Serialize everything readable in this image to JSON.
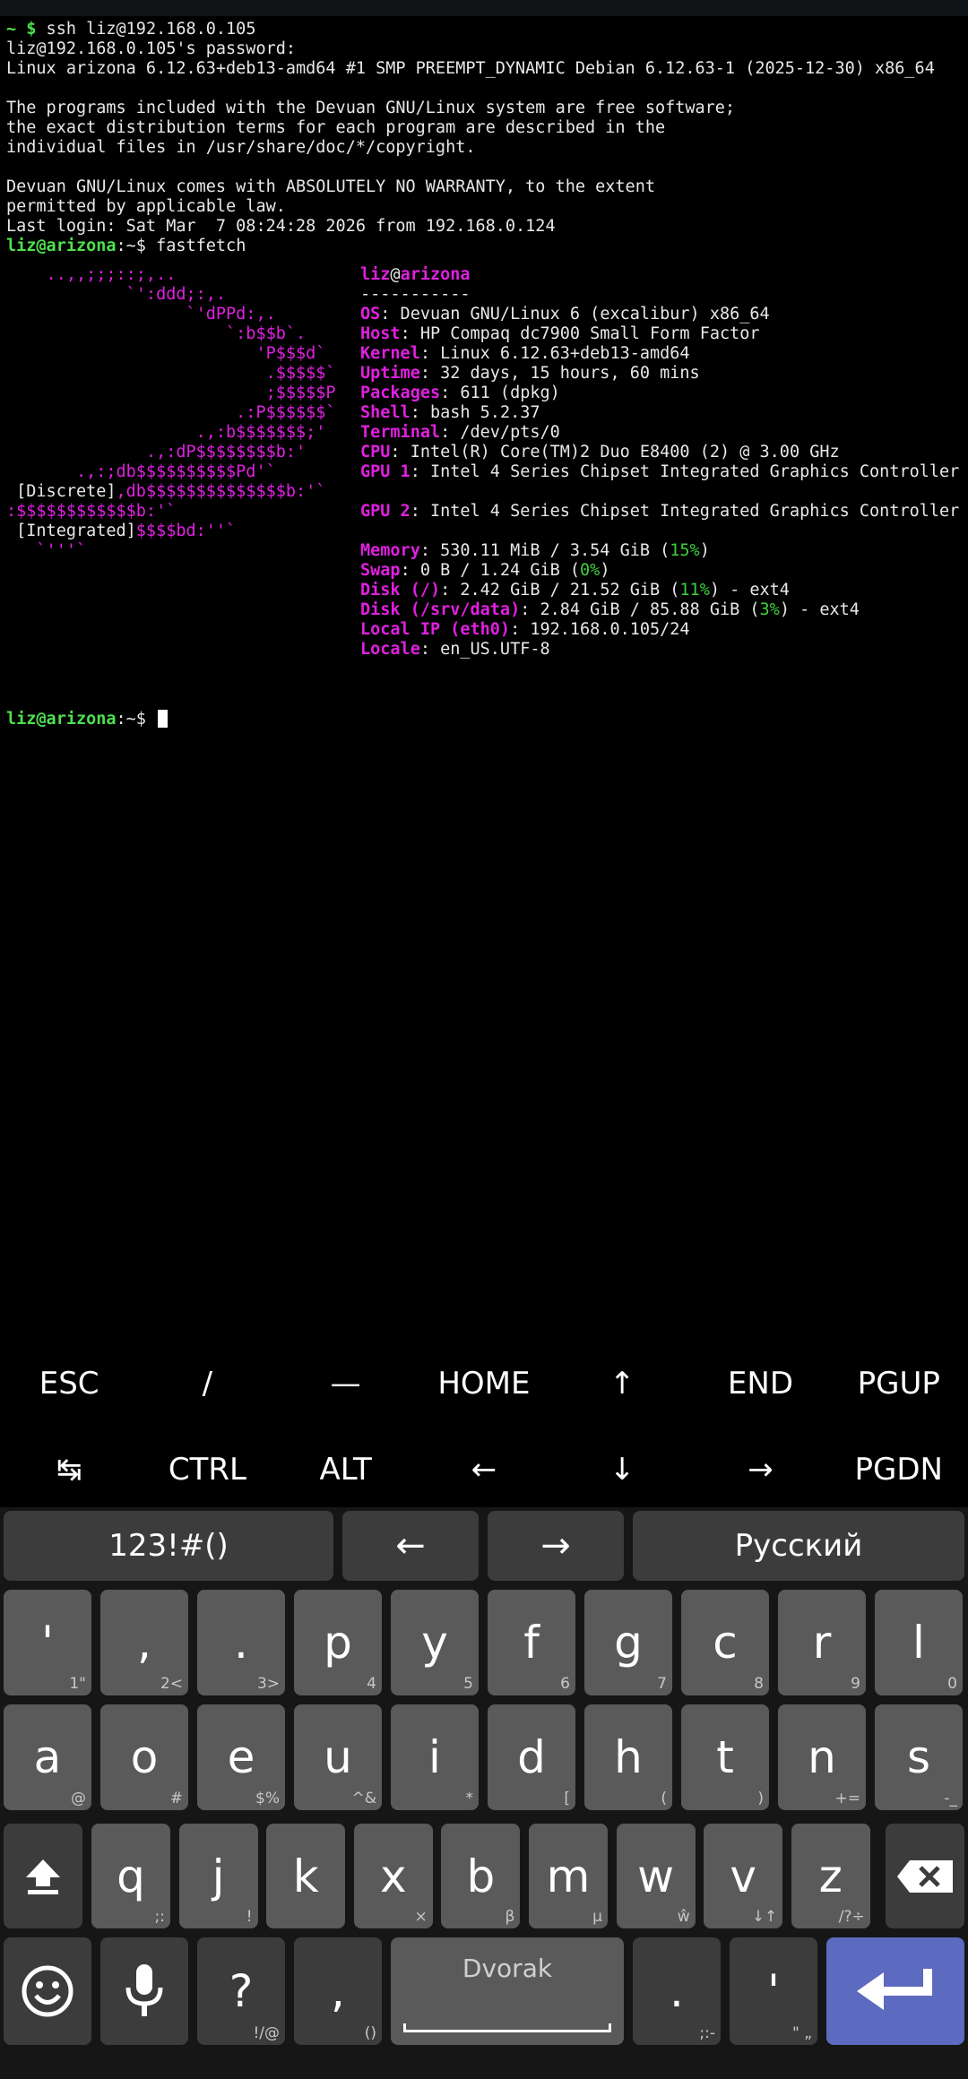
{
  "terminal": {
    "lines": [
      {
        "prompt": "~ $",
        "cmd": " ssh liz@192.168.0.105"
      },
      {
        "text": "liz@192.168.0.105's password:"
      },
      {
        "text": "Linux arizona 6.12.63+deb13-amd64 #1 SMP PREEMPT_DYNAMIC Debian 6.12.63-1 (2025-12-30) x86_64"
      },
      {
        "text": "The programs included with the Devuan GNU/Linux system are free software;"
      },
      {
        "text": "the exact distribution terms for each program are described in the"
      },
      {
        "text": "individual files in /usr/share/doc/*/copyright."
      },
      {
        "text": "Devuan GNU/Linux comes with ABSOLUTELY NO WARRANTY, to the extent"
      },
      {
        "text": "permitted by applicable law."
      },
      {
        "text": "Last login: Sat Mar  7 08:24:28 2026 from 192.168.0.124"
      },
      {
        "prompt": "liz@arizona",
        "sep": ":~$",
        "cmd": " fastfetch"
      }
    ],
    "logo": [
      {
        "a": "    ..,,;;;::;,..",
        "b": ""
      },
      {
        "a": "            `':ddd;:,.",
        "b": ""
      },
      {
        "a": "                  `'dPPd:,.",
        "b": ""
      },
      {
        "a": "                      `:b$$b`.",
        "b": ""
      },
      {
        "a": "                         'P$$$d`",
        "b": ""
      },
      {
        "a": "                          .$$$$$`",
        "b": ""
      },
      {
        "a": "                          ;$$$$$P",
        "b": ""
      },
      {
        "a": "                       .:P$$$$$$`",
        "b": ""
      },
      {
        "a": "                   .,:b$$$$$$$;'",
        "b": ""
      },
      {
        "a": "              .,:dP$$$$$$$$b:'",
        "b": ""
      },
      {
        "a": "       .,:;db$$$$$$$$$$Pd'`",
        "b": ""
      },
      {
        "w": " [Discrete]",
        "a": ",db$$$$$$$$$$$$$$b:'`",
        "b": ""
      },
      {
        "a": ":$$$$$$$$$$$$b:'`",
        "b": ""
      },
      {
        "w": " [Integrated]",
        "a": "$$$$bd:''`",
        "b": ""
      },
      {
        "a": "   `'''`",
        "b": ""
      }
    ],
    "info": {
      "user": "liz",
      "at": "@",
      "host": "arizona",
      "rule": "-----------",
      "rows": [
        {
          "k": "OS",
          "v": ": Devuan GNU/Linux 6 (excalibur) x86_64"
        },
        {
          "k": "Host",
          "v": ": HP Compaq dc7900 Small Form Factor"
        },
        {
          "k": "Kernel",
          "v": ": Linux 6.12.63+deb13-amd64"
        },
        {
          "k": "Uptime",
          "v": ": 32 days, 15 hours, 60 mins"
        },
        {
          "k": "Packages",
          "v": ": 611 (dpkg)"
        },
        {
          "k": "Shell",
          "v": ": bash 5.2.37"
        },
        {
          "k": "Terminal",
          "v": ": /dev/pts/0"
        },
        {
          "k": "CPU",
          "v": ": Intel(R) Core(TM)2 Duo E8400 (2) @ 3.00 GHz"
        },
        {
          "k": "GPU 1",
          "v": ": Intel 4 Series Chipset Integrated Graphics Controller"
        },
        {
          "k": "GPU 2",
          "v": ": Intel 4 Series Chipset Integrated Graphics Controller"
        },
        {
          "k": "Memory",
          "v": ": 530.11 MiB / 3.54 GiB (",
          "p": "15%",
          "e": ")"
        },
        {
          "k": "Swap",
          "v": ": 0 B / 1.24 GiB (",
          "p": "0%",
          "e": ")"
        },
        {
          "k": "Disk (/)",
          "v": ": 2.42 GiB / 21.52 GiB (",
          "p": "11%",
          "e": ") - ext4"
        },
        {
          "k": "Disk (/srv/data)",
          "v": ": 2.84 GiB / 85.88 GiB (",
          "p": "3%",
          "e": ") - ext4"
        },
        {
          "k": "Local IP (eth0)",
          "v": ": 192.168.0.105/24"
        },
        {
          "k": "Locale",
          "v": ": en_US.UTF-8"
        }
      ]
    },
    "final_prompt": {
      "user": "liz@arizona",
      "sep": ":~$"
    }
  },
  "extra_keys": {
    "row1": [
      "ESC",
      "/",
      "—",
      "HOME",
      "↑",
      "END",
      "PGUP"
    ],
    "row2": [
      "↹",
      "CTRL",
      "ALT",
      "←",
      "↓",
      "→",
      "PGDN"
    ]
  },
  "keyboard": {
    "top": {
      "symbols": "123!#()",
      "left": "←",
      "right": "→",
      "language": "Русский"
    },
    "row1": [
      [
        "'",
        "1\""
      ],
      [
        ",",
        "2<"
      ],
      [
        ".",
        "3>"
      ],
      [
        "p",
        "4"
      ],
      [
        "y",
        "5"
      ],
      [
        "f",
        "6"
      ],
      [
        "g",
        "7"
      ],
      [
        "c",
        "8"
      ],
      [
        "r",
        "9"
      ],
      [
        "l",
        "0"
      ]
    ],
    "row2": [
      [
        "a",
        "@"
      ],
      [
        "o",
        "#"
      ],
      [
        "e",
        "$%"
      ],
      [
        "u",
        "^&"
      ],
      [
        "i",
        "*"
      ],
      [
        "d",
        "["
      ],
      [
        "h",
        "("
      ],
      [
        "t",
        ")"
      ],
      [
        "n",
        "+="
      ],
      [
        "s",
        "-_"
      ]
    ],
    "row3": [
      [
        "q",
        ";:"
      ],
      [
        "j",
        "!"
      ],
      [
        "k",
        ""
      ],
      [
        "x",
        "×"
      ],
      [
        "b",
        "β"
      ],
      [
        "m",
        "µ"
      ],
      [
        "w",
        "ŵ"
      ],
      [
        "v",
        "↓↑"
      ],
      [
        "z",
        "/?÷"
      ]
    ],
    "bottom": {
      "question": "?",
      "question_hint": "!/@",
      "comma": ",",
      "comma_hint": "()",
      "space_label": "Dvorak",
      "period": ".",
      "period_hint": ";:-",
      "apostrophe": "'",
      "apostrophe_hint": "\" „"
    }
  }
}
